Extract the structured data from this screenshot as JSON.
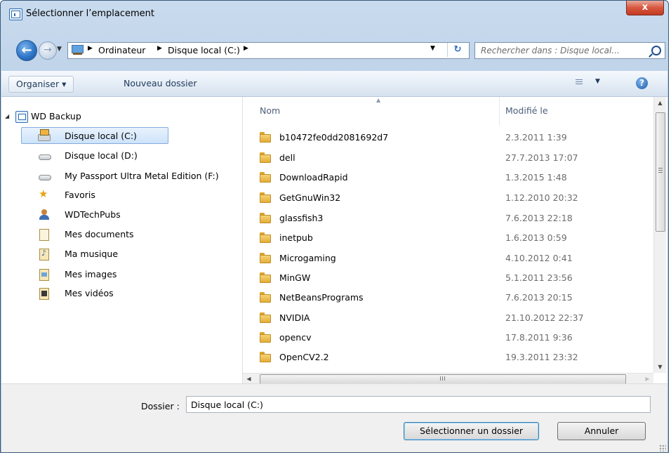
{
  "window": {
    "title": "Sélectionner l’emplacement",
    "close_label": "x"
  },
  "navigation": {
    "breadcrumbs": [
      "Ordinateur",
      "Disque local (C:)"
    ],
    "search_placeholder": "Rechercher dans : Disque local..."
  },
  "toolbar": {
    "organize_label": "Organiser ▾",
    "new_folder_label": "Nouveau dossier"
  },
  "nav_pane": {
    "items": [
      {
        "label": "WD Backup",
        "icon": "wd-backup-icon"
      },
      {
        "label": "Disque local (C:)",
        "icon": "drive-c-icon",
        "selected": true
      },
      {
        "label": "Disque local (D:)",
        "icon": "drive-icon"
      },
      {
        "label": "My Passport Ultra Metal Edition (F:)",
        "icon": "drive-icon"
      },
      {
        "label": "Favoris",
        "icon": "favorites-star-icon"
      },
      {
        "label": "WDTechPubs",
        "icon": "user-folder-icon"
      },
      {
        "label": "Mes documents",
        "icon": "documents-icon"
      },
      {
        "label": "Ma musique",
        "icon": "music-icon"
      },
      {
        "label": "Mes images",
        "icon": "pictures-icon"
      },
      {
        "label": "Mes vidéos",
        "icon": "videos-icon"
      }
    ]
  },
  "file_list": {
    "columns": {
      "name": "Nom",
      "modified": "Modifié le"
    },
    "rows": [
      {
        "name": "b10472fe0dd2081692d7",
        "modified": "2.3.2011 1:39"
      },
      {
        "name": "dell",
        "modified": "27.7.2013 17:07"
      },
      {
        "name": "DownloadRapid",
        "modified": "1.3.2015 1:48"
      },
      {
        "name": "GetGnuWin32",
        "modified": "1.12.2010 20:32"
      },
      {
        "name": "glassfish3",
        "modified": "7.6.2013 22:18"
      },
      {
        "name": "inetpub",
        "modified": "1.6.2013 0:59"
      },
      {
        "name": "Microgaming",
        "modified": "4.10.2012 0:41"
      },
      {
        "name": "MinGW",
        "modified": "5.1.2011 23:56"
      },
      {
        "name": "NetBeansPrograms",
        "modified": "7.6.2013 20:15"
      },
      {
        "name": "NVIDIA",
        "modified": "21.10.2012 22:37"
      },
      {
        "name": "opencv",
        "modified": "17.8.2011 9:36"
      },
      {
        "name": "OpenCV2.2",
        "modified": "19.3.2011 23:32"
      }
    ]
  },
  "footer": {
    "folder_label": "Dossier :",
    "folder_value": "Disque local (C:)",
    "select_button": "Sélectionner un dossier",
    "cancel_button": "Annuler"
  }
}
